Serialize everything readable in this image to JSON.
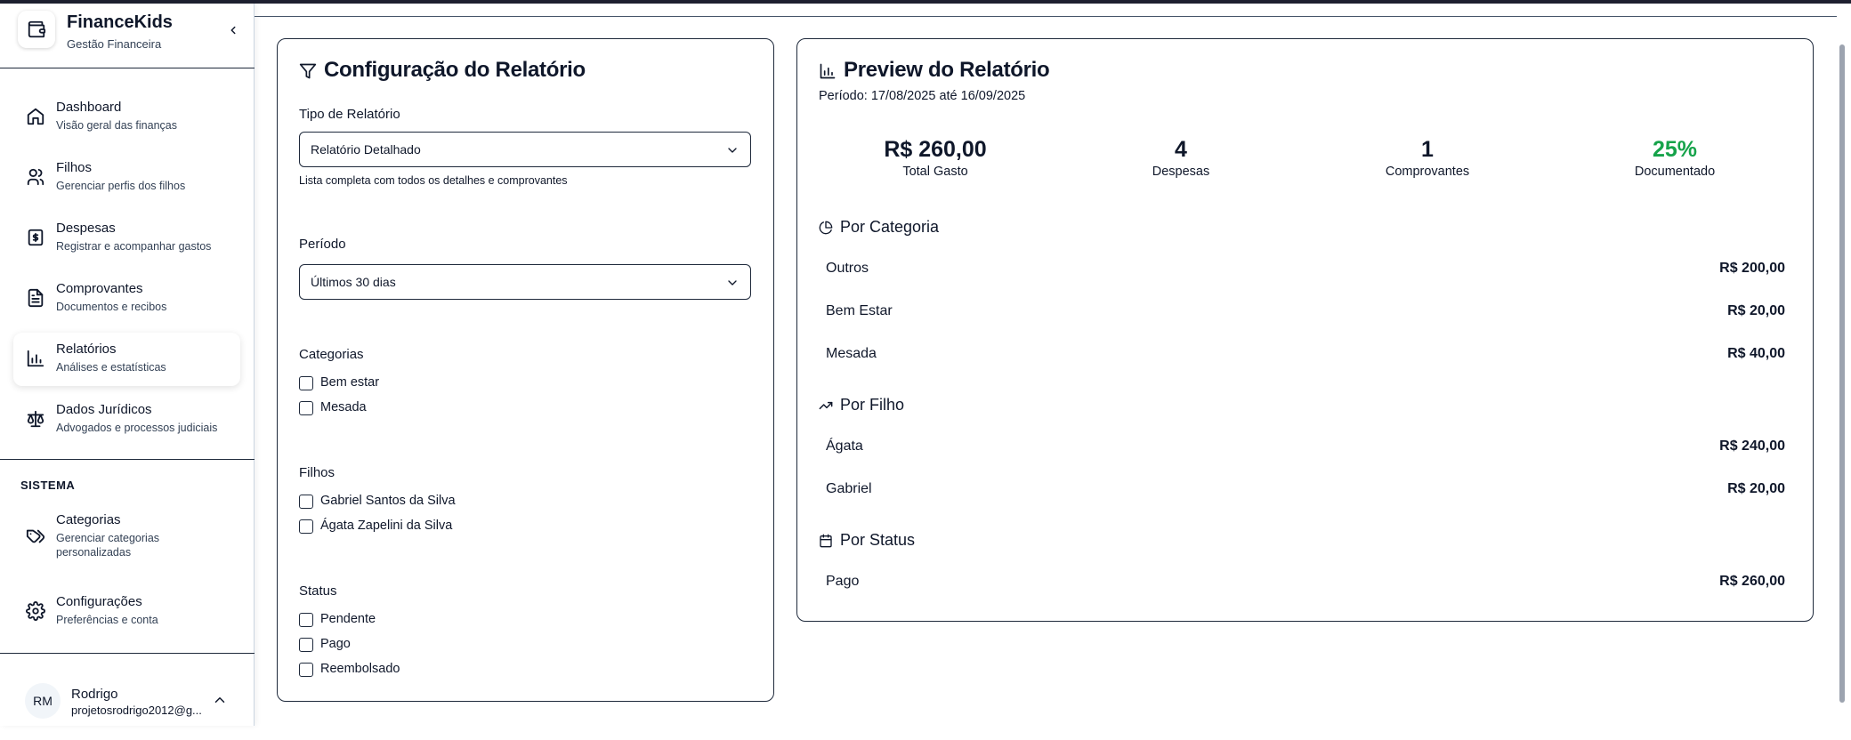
{
  "brand": {
    "title": "FinanceKids",
    "subtitle": "Gestão Financeira"
  },
  "sidebar": {
    "items": [
      {
        "label": "Dashboard",
        "sub": "Visão geral das finanças"
      },
      {
        "label": "Filhos",
        "sub": "Gerenciar perfis dos filhos"
      },
      {
        "label": "Despesas",
        "sub": "Registrar e acompanhar gastos"
      },
      {
        "label": "Comprovantes",
        "sub": "Documentos e recibos"
      },
      {
        "label": "Relatórios",
        "sub": "Análises e estatísticas"
      },
      {
        "label": "Dados Jurídicos",
        "sub": "Advogados e processos judiciais"
      }
    ],
    "section_label": "SISTEMA",
    "system_items": [
      {
        "label": "Categorias",
        "sub": "Gerenciar categorias personalizadas"
      },
      {
        "label": "Configurações",
        "sub": "Preferências e conta"
      }
    ]
  },
  "user": {
    "initials": "RM",
    "name": "Rodrigo",
    "email": "projetosrodrigo2012@g..."
  },
  "config": {
    "title": "Configuração do Relatório",
    "report_type_label": "Tipo de Relatório",
    "report_type_value": "Relatório Detalhado",
    "report_type_hint": "Lista completa com todos os detalhes e comprovantes",
    "period_label": "Período",
    "period_value": "Últimos 30 dias",
    "categories_label": "Categorias",
    "categories": [
      "Bem estar",
      "Mesada"
    ],
    "children_label": "Filhos",
    "children": [
      "Gabriel Santos da Silva",
      "Ágata Zapelini da Silva"
    ],
    "status_label": "Status",
    "statuses": [
      "Pendente",
      "Pago",
      "Reembolsado"
    ]
  },
  "preview": {
    "title": "Preview do Relatório",
    "period": "Período: 17/08/2025 até 16/09/2025",
    "stats": [
      {
        "value": "R$ 260,00",
        "label": "Total Gasto"
      },
      {
        "value": "4",
        "label": "Despesas"
      },
      {
        "value": "1",
        "label": "Comprovantes"
      },
      {
        "value": "25%",
        "label": "Documentado"
      }
    ],
    "by_category_title": "Por Categoria",
    "by_category": [
      {
        "label": "Outros",
        "value": "R$ 200,00"
      },
      {
        "label": "Bem Estar",
        "value": "R$ 20,00"
      },
      {
        "label": "Mesada",
        "value": "R$ 40,00"
      }
    ],
    "by_child_title": "Por Filho",
    "by_child": [
      {
        "label": "Ágata",
        "value": "R$ 240,00"
      },
      {
        "label": "Gabriel",
        "value": "R$ 20,00"
      }
    ],
    "by_status_title": "Por Status",
    "by_status": [
      {
        "label": "Pago",
        "value": "R$ 260,00"
      }
    ]
  },
  "colors": {
    "accent_green": "#16a34a",
    "text": "#0f172a",
    "border": "#1e293b"
  }
}
